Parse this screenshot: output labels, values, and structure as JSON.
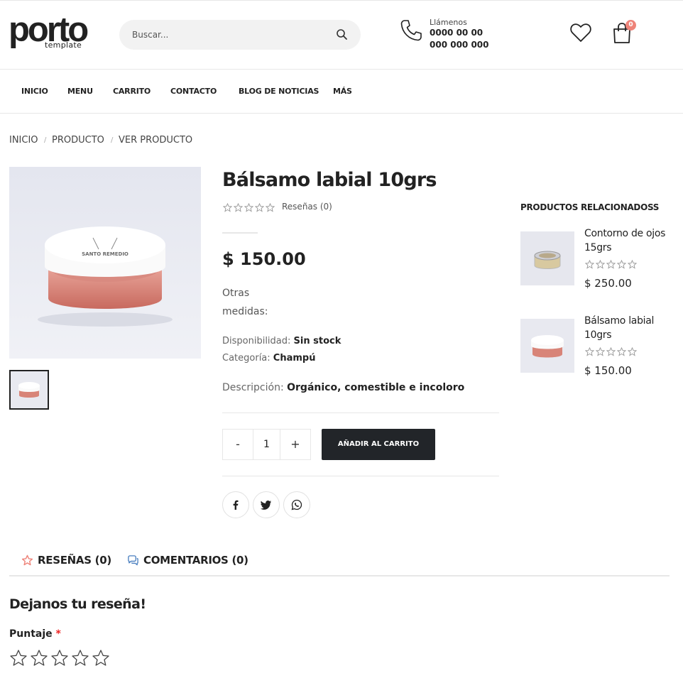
{
  "brand": {
    "logo_main": "porto",
    "logo_sub": "template"
  },
  "search": {
    "placeholder": "Buscar..."
  },
  "contact": {
    "label": "Llámenos",
    "phone1": "0000 00 00",
    "phone2": "000 000 000"
  },
  "cart": {
    "count": "0"
  },
  "nav": {
    "items": [
      "INICIO",
      "MENU",
      "CARRITO",
      "CONTACTO",
      "BLOG DE NOTICIAS",
      "MÁS"
    ]
  },
  "breadcrumb": {
    "items": [
      "INICIO",
      "PRODUCTO",
      "VER PRODUCTO"
    ],
    "separator": "/"
  },
  "product": {
    "title": "Bálsamo labial 10grs",
    "reviews": "Reseñas (0)",
    "price": "$ 150.00",
    "other_sizes": "Otras medidas:",
    "availability_label": "Disponibilidad:",
    "availability_value": "Sin stock",
    "category_label": "Categoría:",
    "category_value": "Champú",
    "description_label": "Descripción:",
    "description_value": "Orgánico, comestible e incoloro",
    "quantity": "1",
    "minus": "-",
    "plus": "+",
    "add_to_cart": "AÑADIR AL CARRITO",
    "jar_label": "SANTO REMEDIO",
    "rating": 0
  },
  "related": {
    "title": "PRODUCTOS RELACIONADOSS",
    "items": [
      {
        "name": "Contorno de ojos 15grs",
        "price": "$ 250.00",
        "rating": 0
      },
      {
        "name": "Bálsamo labial 10grs",
        "price": "$ 150.00",
        "rating": 0
      }
    ]
  },
  "tabs": {
    "reviews": "RESEÑAS (0)",
    "comments": "COMENTARIOS (0)"
  },
  "review_form": {
    "heading": "Dejanos tu reseña!",
    "rating_label": "Puntaje",
    "required_mark": "*"
  },
  "colors": {
    "accent": "#ee8379",
    "dark_button": "#222529",
    "divider": "#e7e7e7"
  },
  "icons": [
    "search-icon",
    "phone-icon",
    "heart-icon",
    "bag-icon",
    "facebook-icon",
    "twitter-icon",
    "whatsapp-icon",
    "star-icon",
    "comments-icon"
  ]
}
